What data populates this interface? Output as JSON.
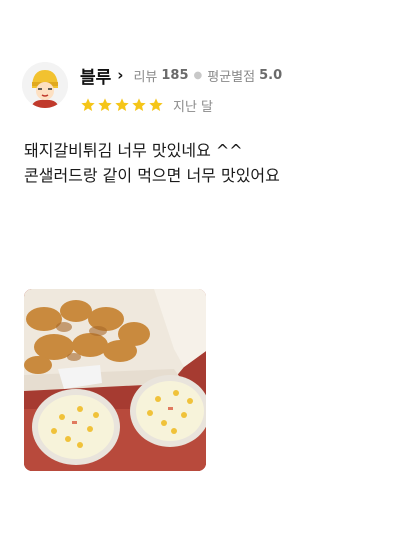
{
  "review": {
    "author": {
      "name": "블루",
      "avatar": "cartoon-avatar"
    },
    "stats": {
      "review_label": "리뷰",
      "review_count": "185",
      "avg_label": "평균별점",
      "avg_value": "5.0"
    },
    "rating": {
      "stars": 5,
      "max": 5,
      "color": "#f5c518"
    },
    "date": "지난 달",
    "text": "돼지갈비튀김 너무 맛있네요 ^^\n콘샐러드랑 같이 먹으면 너무 맛있어요",
    "photo": {
      "subject": "fried-pork-and-corn-salad-photo"
    }
  }
}
